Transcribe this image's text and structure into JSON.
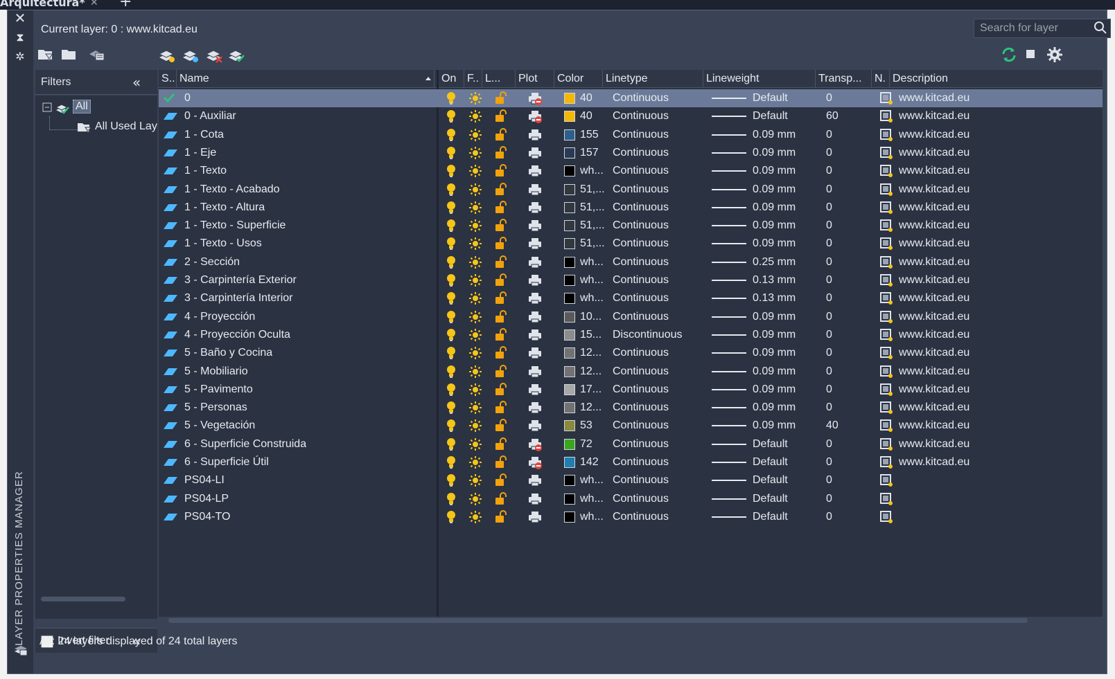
{
  "window": {
    "document_tab": "Arquitectura*",
    "palette_title": "LAYER PROPERTIES MANAGER"
  },
  "header": {
    "current_layer": "Current layer: 0 : www.kitcad.eu",
    "search_placeholder": "Search for layer"
  },
  "filters": {
    "title": "Filters",
    "tree_all": "All",
    "tree_used": "All Used Layers",
    "invert_label": "Invert filter",
    "invert_checked": false
  },
  "columns": {
    "status": "S..",
    "name": "Name",
    "on": "On",
    "freeze": "F..",
    "lock": "L...",
    "plot": "Plot",
    "color": "Color",
    "linetype": "Linetype",
    "lineweight": "Lineweight",
    "transparency": "Transp...",
    "newvp": "N.",
    "description": "Description"
  },
  "colors": {
    "accent_green": "#2ec27e",
    "layer_cyan": "#4db8ff",
    "bulb_yellow": "#f5c518",
    "lock_orange": "#f2a20c",
    "plot_red": "#e0443e"
  },
  "layers": [
    {
      "name": "0",
      "current": true,
      "plot_off": true,
      "color_hex": "#f5b800",
      "color": "40",
      "linetype": "Continuous",
      "lineweight": "Default",
      "transparency": "0",
      "description": "www.kitcad.eu"
    },
    {
      "name": "0 - Auxiliar",
      "current": false,
      "plot_off": true,
      "color_hex": "#f5b800",
      "color": "40",
      "linetype": "Continuous",
      "lineweight": "Default",
      "transparency": "60",
      "description": "www.kitcad.eu"
    },
    {
      "name": "1 - Cota",
      "current": false,
      "plot_off": false,
      "color_hex": "#2d5f8a",
      "color": "155",
      "linetype": "Continuous",
      "lineweight": "0.09 mm",
      "transparency": "0",
      "description": "www.kitcad.eu"
    },
    {
      "name": "1 - Eje",
      "current": false,
      "plot_off": false,
      "color_hex": "#2a3a55",
      "color": "157",
      "linetype": "Continuous",
      "lineweight": "0.09 mm",
      "transparency": "0",
      "description": "www.kitcad.eu"
    },
    {
      "name": "1 - Texto",
      "current": false,
      "plot_off": false,
      "color_hex": "#000000",
      "color": "wh...",
      "linetype": "Continuous",
      "lineweight": "0.09 mm",
      "transparency": "0",
      "description": "www.kitcad.eu"
    },
    {
      "name": "1 - Texto - Acabado",
      "current": false,
      "plot_off": false,
      "color_hex": "#33383f",
      "color": "51,...",
      "linetype": "Continuous",
      "lineweight": "0.09 mm",
      "transparency": "0",
      "description": "www.kitcad.eu"
    },
    {
      "name": "1 - Texto - Altura",
      "current": false,
      "plot_off": false,
      "color_hex": "#33383f",
      "color": "51,...",
      "linetype": "Continuous",
      "lineweight": "0.09 mm",
      "transparency": "0",
      "description": "www.kitcad.eu"
    },
    {
      "name": "1 - Texto - Superficie",
      "current": false,
      "plot_off": false,
      "color_hex": "#33383f",
      "color": "51,...",
      "linetype": "Continuous",
      "lineweight": "0.09 mm",
      "transparency": "0",
      "description": "www.kitcad.eu"
    },
    {
      "name": "1 - Texto - Usos",
      "current": false,
      "plot_off": false,
      "color_hex": "#33383f",
      "color": "51,...",
      "linetype": "Continuous",
      "lineweight": "0.09 mm",
      "transparency": "0",
      "description": "www.kitcad.eu"
    },
    {
      "name": "2 - Sección",
      "current": false,
      "plot_off": false,
      "color_hex": "#000000",
      "color": "wh...",
      "linetype": "Continuous",
      "lineweight": "0.25 mm",
      "transparency": "0",
      "description": "www.kitcad.eu"
    },
    {
      "name": "3 - Carpintería Exterior",
      "current": false,
      "plot_off": false,
      "color_hex": "#000000",
      "color": "wh...",
      "linetype": "Continuous",
      "lineweight": "0.13 mm",
      "transparency": "0",
      "description": "www.kitcad.eu"
    },
    {
      "name": "3 - Carpintería Interior",
      "current": false,
      "plot_off": false,
      "color_hex": "#000000",
      "color": "wh...",
      "linetype": "Continuous",
      "lineweight": "0.13 mm",
      "transparency": "0",
      "description": "www.kitcad.eu"
    },
    {
      "name": "4 - Proyección",
      "current": false,
      "plot_off": false,
      "color_hex": "#5a5a5a",
      "color": "10...",
      "linetype": "Continuous",
      "lineweight": "0.09 mm",
      "transparency": "0",
      "description": "www.kitcad.eu"
    },
    {
      "name": "4 - Proyección Oculta",
      "current": false,
      "plot_off": false,
      "color_hex": "#8c8c8c",
      "color": "15...",
      "linetype": "Discontinuous",
      "lineweight": "0.09 mm",
      "transparency": "0",
      "description": "www.kitcad.eu"
    },
    {
      "name": "5 - Baño y Cocina",
      "current": false,
      "plot_off": false,
      "color_hex": "#727272",
      "color": "12...",
      "linetype": "Continuous",
      "lineweight": "0.09 mm",
      "transparency": "0",
      "description": "www.kitcad.eu"
    },
    {
      "name": "5 - Mobiliario",
      "current": false,
      "plot_off": false,
      "color_hex": "#727272",
      "color": "12...",
      "linetype": "Continuous",
      "lineweight": "0.09 mm",
      "transparency": "0",
      "description": "www.kitcad.eu"
    },
    {
      "name": "5 - Pavimento",
      "current": false,
      "plot_off": false,
      "color_hex": "#a8a8a8",
      "color": "17...",
      "linetype": "Continuous",
      "lineweight": "0.09 mm",
      "transparency": "0",
      "description": "www.kitcad.eu"
    },
    {
      "name": "5 - Personas",
      "current": false,
      "plot_off": false,
      "color_hex": "#727272",
      "color": "12...",
      "linetype": "Continuous",
      "lineweight": "0.09 mm",
      "transparency": "0",
      "description": "www.kitcad.eu"
    },
    {
      "name": "5 - Vegetación",
      "current": false,
      "plot_off": false,
      "color_hex": "#8a8a3a",
      "color": "53",
      "linetype": "Continuous",
      "lineweight": "0.09 mm",
      "transparency": "40",
      "description": "www.kitcad.eu"
    },
    {
      "name": "6 - Superficie Construida",
      "current": false,
      "plot_off": true,
      "color_hex": "#3aa61e",
      "color": "72",
      "linetype": "Continuous",
      "lineweight": "Default",
      "transparency": "0",
      "description": "www.kitcad.eu"
    },
    {
      "name": "6 - Superficie Útil",
      "current": false,
      "plot_off": true,
      "color_hex": "#1e7fb0",
      "color": "142",
      "linetype": "Continuous",
      "lineweight": "Default",
      "transparency": "0",
      "description": "www.kitcad.eu"
    },
    {
      "name": "PS04-LI",
      "current": false,
      "plot_off": false,
      "color_hex": "#000000",
      "color": "wh...",
      "linetype": "Continuous",
      "lineweight": "Default",
      "transparency": "0",
      "description": ""
    },
    {
      "name": "PS04-LP",
      "current": false,
      "plot_off": false,
      "color_hex": "#000000",
      "color": "wh...",
      "linetype": "Continuous",
      "lineweight": "Default",
      "transparency": "0",
      "description": ""
    },
    {
      "name": "PS04-TO",
      "current": false,
      "plot_off": false,
      "color_hex": "#000000",
      "color": "wh...",
      "linetype": "Continuous",
      "lineweight": "Default",
      "transparency": "0",
      "description": ""
    }
  ],
  "status_bar": "All: 24 layers displayed of 24 total layers"
}
